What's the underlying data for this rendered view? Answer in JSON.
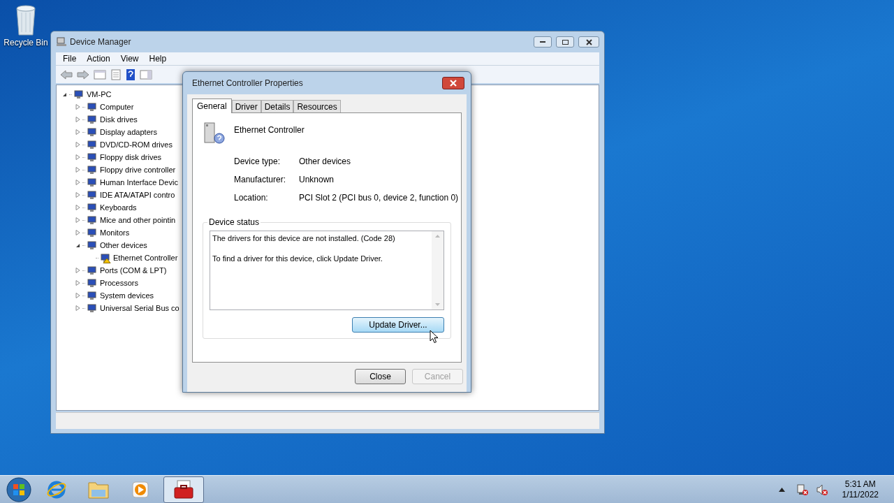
{
  "desktop_icons": [
    {
      "label": "Recycle Bin"
    }
  ],
  "device_manager": {
    "title": "Device Manager",
    "menu": [
      "File",
      "Action",
      "View",
      "Help"
    ],
    "tree": {
      "label": "VM-PC",
      "expanded": true,
      "children": [
        {
          "label": "Computer",
          "expanded": false
        },
        {
          "label": "Disk drives",
          "expanded": false
        },
        {
          "label": "Display adapters",
          "expanded": false
        },
        {
          "label": "DVD/CD-ROM drives",
          "expanded": false
        },
        {
          "label": "Floppy disk drives",
          "expanded": false
        },
        {
          "label": "Floppy drive controller",
          "expanded": false
        },
        {
          "label": "Human Interface Devic",
          "expanded": false
        },
        {
          "label": "IDE ATA/ATAPI contro",
          "expanded": false
        },
        {
          "label": "Keyboards",
          "expanded": false
        },
        {
          "label": "Mice and other pointin",
          "expanded": false
        },
        {
          "label": "Monitors",
          "expanded": false
        },
        {
          "label": "Other devices",
          "expanded": true,
          "children": [
            {
              "label": "Ethernet Controller",
              "warning": true
            }
          ]
        },
        {
          "label": "Ports (COM & LPT)",
          "expanded": false
        },
        {
          "label": "Processors",
          "expanded": false
        },
        {
          "label": "System devices",
          "expanded": false
        },
        {
          "label": "Universal Serial Bus co",
          "expanded": false
        }
      ]
    }
  },
  "dialog": {
    "title": "Ethernet Controller Properties",
    "tabs": [
      {
        "label": "General",
        "selected": true
      },
      {
        "label": "Driver",
        "selected": false
      },
      {
        "label": "Details",
        "selected": false
      },
      {
        "label": "Resources",
        "selected": false
      }
    ],
    "device_name": "Ethernet Controller",
    "properties": [
      {
        "label": "Device type:",
        "value": "Other devices"
      },
      {
        "label": "Manufacturer:",
        "value": "Unknown"
      },
      {
        "label": "Location:",
        "value": "PCI Slot 2 (PCI bus 0, device 2, function 0)"
      }
    ],
    "status_group": {
      "title": "Device status",
      "lines": [
        "The drivers for this device are not installed. (Code 28)",
        "To find a driver for this device, click Update Driver."
      ],
      "button": "Update Driver..."
    },
    "buttons": [
      {
        "label": "Close",
        "disabled": false
      },
      {
        "label": "Cancel",
        "disabled": true
      }
    ]
  },
  "taskbar": {
    "items": [
      {
        "kind": "ie",
        "selected": false
      },
      {
        "kind": "explorer",
        "selected": false
      },
      {
        "kind": "media",
        "selected": false
      },
      {
        "kind": "devmgr",
        "selected": true
      }
    ],
    "time": "5:31 AM",
    "date": "1/11/2022"
  }
}
